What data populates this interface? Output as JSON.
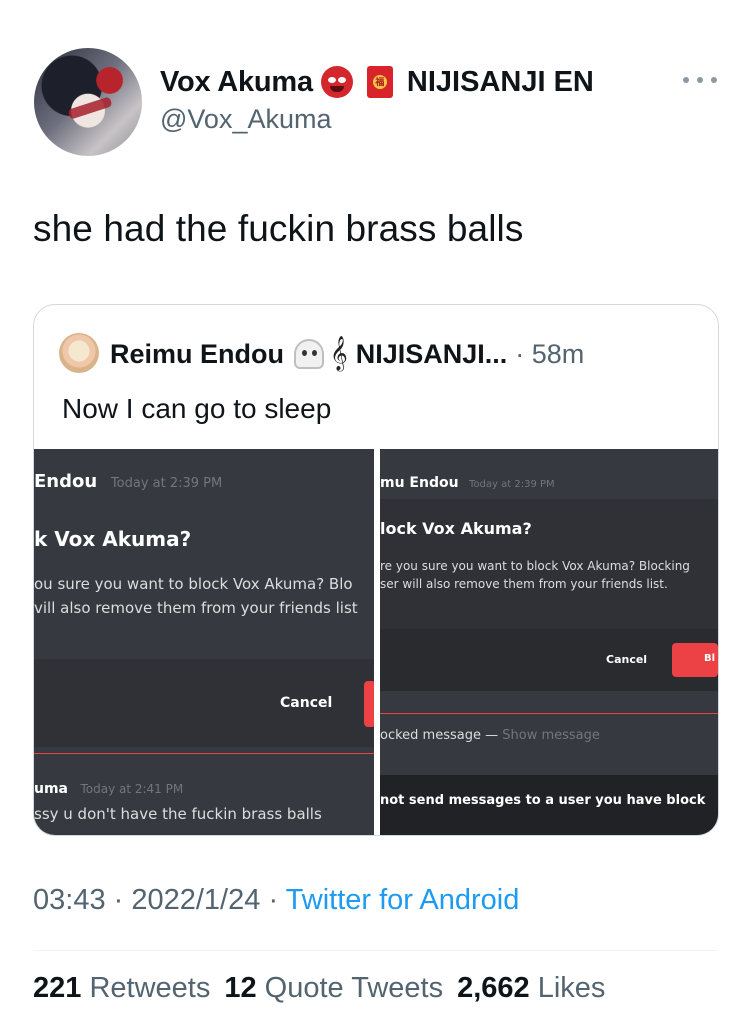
{
  "author": {
    "name": "Vox Akuma",
    "badge_label": "NIJISANJI EN",
    "handle": "@Vox_Akuma",
    "badge_envelope_char": "福"
  },
  "tweet": {
    "text": "she had the fuckin brass balls"
  },
  "quoted": {
    "name": "Reimu Endou",
    "badge_label": "NIJISANJI...",
    "time": "· 58m",
    "text": "Now I can go to sleep",
    "music_glyph": "𝄞"
  },
  "screenshot_left": {
    "msg1_user": "Endou",
    "msg1_time": "Today at 2:39 PM",
    "dialog_title": "k Vox Akuma?",
    "dialog_body_line1": "ou sure you want to block Vox Akuma? Blo",
    "dialog_body_line2": "vill also remove them from your friends list",
    "cancel_label": "Cancel",
    "msg2_user": "uma",
    "msg2_time": "Today at 2:41 PM",
    "msg2_text": "ssy u don't have the fuckin brass balls"
  },
  "screenshot_right": {
    "msg1_user": "mu Endou",
    "msg1_time": "Today at 2:39 PM",
    "dialog_title": "lock Vox Akuma?",
    "dialog_body_line1": "re you sure you want to block Vox Akuma? Blocking",
    "dialog_body_line2": "ser will also remove them from your friends list.",
    "cancel_label": "Cancel",
    "block_label": "Bl",
    "blocked_text": "ocked message —",
    "show_message": "Show message",
    "banner": "not send messages to a user you have block"
  },
  "footer": {
    "time": "03:43",
    "date": "2022/1/24",
    "source": "Twitter for Android",
    "retweets_count": "221",
    "retweets_label": "Retweets",
    "quotes_count": "12",
    "quotes_label": "Quote Tweets",
    "likes_count": "2,662",
    "likes_label": "Likes"
  },
  "colors": {
    "link": "#1d9bf0",
    "muted": "#536471",
    "discord_bg": "#36393f",
    "discord_red": "#ed4245"
  }
}
